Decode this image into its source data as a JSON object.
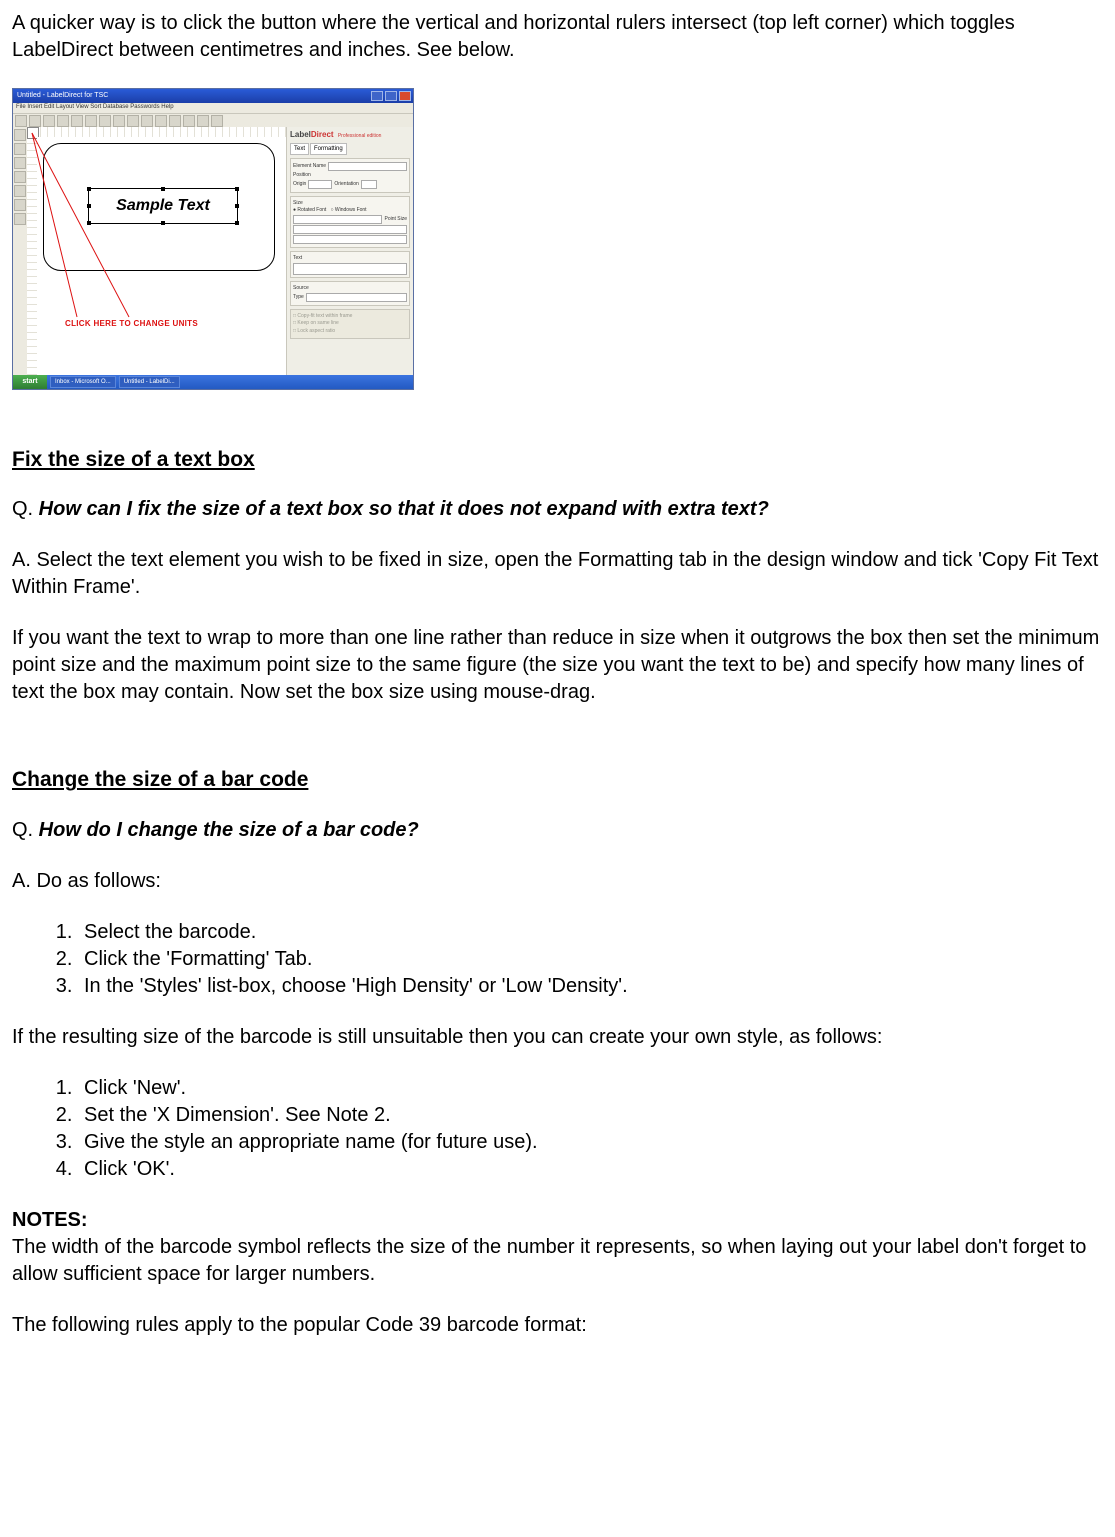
{
  "intro": "A quicker way is to click the button where the vertical and horizontal rulers intersect (top left corner) which toggles LabelDirect between centimetres and inches. See below.",
  "screenshot": {
    "titlebar": "Untitled - LabelDirect for TSC",
    "menu": "File  Insert  Edit  Layout  View  Sort  Database  Passwords  Help",
    "sample_text": "Sample Text",
    "callout": "CLICK HERE TO CHANGE UNITS",
    "panel_brand_a": "Label",
    "panel_brand_b": "Direct",
    "panel_edition": "Professional edition",
    "tab_text": "Text",
    "tab_formatting": "Formatting",
    "taskbar_start": "start"
  },
  "s1": {
    "heading": "Fix the size of a text box",
    "q_prefix": "Q.  ",
    "q": "How can I fix the size of a text box so that it does not expand with extra text?",
    "a": "A.  Select the text element you wish to be fixed in size, open the Formatting tab in the design window and tick 'Copy Fit Text Within Frame'.",
    "p2": "If you want the text to wrap to more than one line rather than reduce in size when it outgrows the box then set the minimum point size and the maximum point size to the same figure (the size you want the text to be) and specify how many lines of text the box may contain.  Now set the box size using mouse-drag."
  },
  "s2": {
    "heading": "Change the size of a bar code",
    "q_prefix": "Q.  ",
    "q": "How do I change the size of a bar code?",
    "a": "A.  Do as follows:",
    "list1": [
      "Select the barcode.",
      "Click the 'Formatting' Tab.",
      "In the 'Styles' list-box, choose 'High Density' or 'Low 'Density'."
    ],
    "mid": "If the resulting size of the barcode is still unsuitable then you can create your own style, as follows:",
    "list2": [
      "Click 'New'.",
      "Set the 'X Dimension'.  See Note 2.",
      "Give the style an appropriate name (for future use).",
      "Click 'OK'."
    ],
    "notes_label": "NOTES:",
    "notes_p1": "The width of the barcode symbol reflects the size of the number it represents, so when laying out your label don't forget to allow sufficient space for larger numbers.",
    "notes_p2": "The following rules apply to the popular Code 39 barcode format:"
  }
}
